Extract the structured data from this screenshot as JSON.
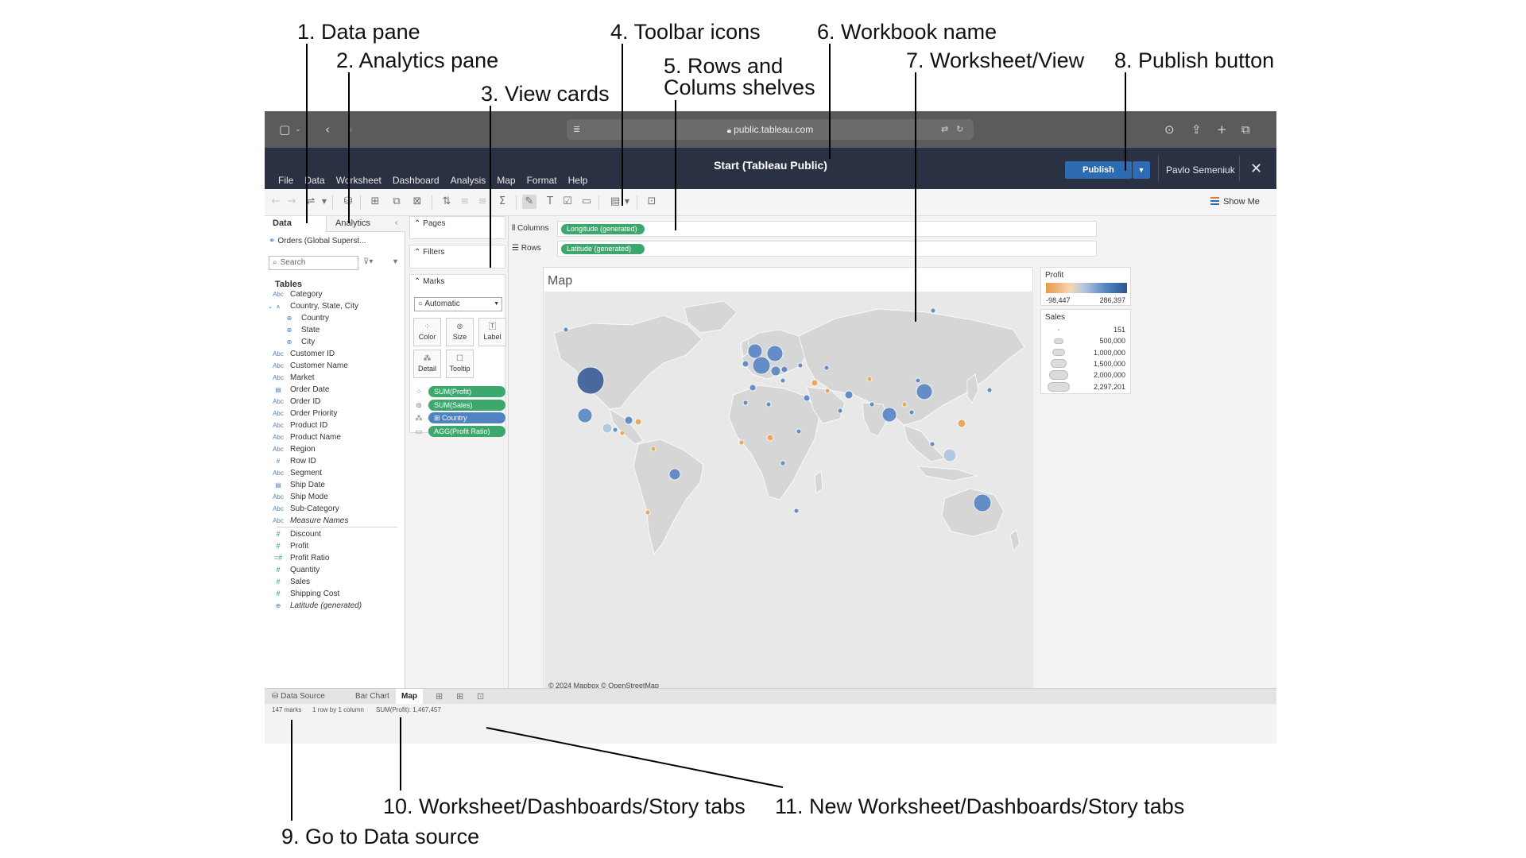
{
  "callouts": {
    "c1": "1. Data pane",
    "c2": "2. Analytics pane",
    "c3": "3. View cards",
    "c4": "4. Toolbar icons",
    "c5a": "5. Rows and",
    "c5b": "Colums shelves",
    "c6": "6. Workbook name",
    "c7": "7. Worksheet/View",
    "c8": "8. Publish button",
    "c9": "9. Go to Data source",
    "c10": "10. Worksheet/Dashboards/Story tabs",
    "c11": "11. New Worksheet/Dashboards/Story tabs"
  },
  "browser": {
    "url": "public.tableau.com",
    "icons": [
      "sidebar-icon",
      "back-icon",
      "forward-icon",
      "reader-icon",
      "translate-icon",
      "reload-icon",
      "download-icon",
      "share-icon",
      "new-tab-icon",
      "tabs-overview-icon"
    ]
  },
  "menu": {
    "items": [
      "File",
      "Data",
      "Worksheet",
      "Dashboard",
      "Analysis",
      "Map",
      "Format",
      "Help"
    ],
    "workbook_name": "Start (Tableau Public)",
    "publish_label": "Publish",
    "user_name": "Pavlo Semeniuk"
  },
  "toolbar": {
    "show_me": "Show Me"
  },
  "data_pane": {
    "tab_data": "Data",
    "tab_analytics": "Analytics",
    "data_source": "Orders (Global Superst...",
    "search_placeholder": "Search",
    "tables_heading": "Tables",
    "dimensions": [
      {
        "name": "Category",
        "type": "Abc"
      },
      {
        "name": "Country, State, City",
        "type": "hierarchy"
      },
      {
        "name": "Country",
        "type": "geo"
      },
      {
        "name": "State",
        "type": "geo"
      },
      {
        "name": "City",
        "type": "geo"
      },
      {
        "name": "Customer ID",
        "type": "Abc"
      },
      {
        "name": "Customer Name",
        "type": "Abc"
      },
      {
        "name": "Market",
        "type": "Abc"
      },
      {
        "name": "Order Date",
        "type": "date"
      },
      {
        "name": "Order ID",
        "type": "Abc"
      },
      {
        "name": "Order Priority",
        "type": "Abc"
      },
      {
        "name": "Product ID",
        "type": "Abc"
      },
      {
        "name": "Product Name",
        "type": "Abc"
      },
      {
        "name": "Region",
        "type": "Abc"
      },
      {
        "name": "Row ID",
        "type": "number"
      },
      {
        "name": "Segment",
        "type": "Abc"
      },
      {
        "name": "Ship Date",
        "type": "date"
      },
      {
        "name": "Ship Mode",
        "type": "Abc"
      },
      {
        "name": "Sub-Category",
        "type": "Abc"
      },
      {
        "name": "Measure Names",
        "type": "Abc"
      }
    ],
    "measures": [
      {
        "name": "Discount",
        "type": "number"
      },
      {
        "name": "Profit",
        "type": "number"
      },
      {
        "name": "Profit Ratio",
        "type": "calc"
      },
      {
        "name": "Quantity",
        "type": "number"
      },
      {
        "name": "Sales",
        "type": "number"
      },
      {
        "name": "Shipping Cost",
        "type": "number"
      },
      {
        "name": "Latitude (generated)",
        "type": "geo"
      }
    ]
  },
  "cards": {
    "pages": "Pages",
    "filters": "Filters",
    "marks": "Marks",
    "mark_type": "Automatic",
    "buttons": [
      "Color",
      "Size",
      "Label",
      "Detail",
      "Tooltip"
    ],
    "pills": [
      {
        "icon": "color-icon",
        "label": "SUM(Profit)",
        "color": "#3ca86e"
      },
      {
        "icon": "size-icon",
        "label": "SUM(Sales)",
        "color": "#3ca86e"
      },
      {
        "icon": "detail-icon",
        "label": "⊞ Country",
        "color": "#4f83c1"
      },
      {
        "icon": "tooltip-icon",
        "label": "AGG(Profit Ratio)",
        "color": "#3ca86e"
      }
    ]
  },
  "shelves": {
    "columns_label": "Columns",
    "columns_pill": "Longitude (generated)",
    "rows_label": "Rows",
    "rows_pill": "Latitude (generated)"
  },
  "view": {
    "title": "Map",
    "attribution": "© 2024 Mapbox  © OpenStreetMap"
  },
  "legends": {
    "profit_title": "Profit",
    "profit_min": "-98,447",
    "profit_max": "286,397",
    "sales_title": "Sales",
    "sales_values": [
      "151",
      "500,000",
      "1,000,000",
      "1,500,000",
      "2,000,000",
      "2,297,201"
    ]
  },
  "sheet_tabs": {
    "data_source": "Data Source",
    "tabs": [
      "Bar Chart",
      "Map"
    ],
    "active": "Map"
  },
  "status": {
    "marks": "147 marks",
    "dims": "1 row by 1 column",
    "sum": "SUM(Profit): 1,467,457"
  },
  "colors": {
    "profit_low": "#e89a4a",
    "profit_high": "#2e5590",
    "pill_measure": "#3ca86e",
    "pill_dimension": "#4f83c1",
    "publish": "#2d6bb3",
    "menu_bar": "#2a3142"
  }
}
